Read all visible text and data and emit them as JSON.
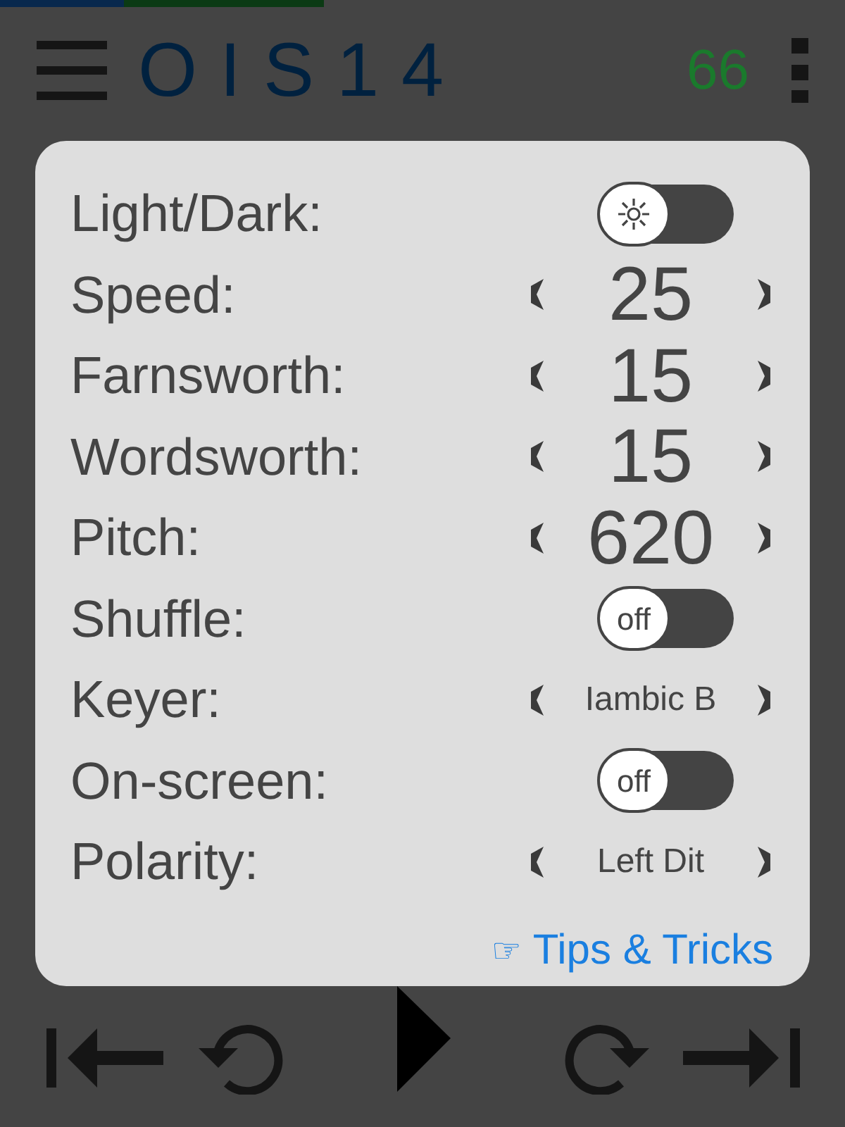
{
  "progress": {
    "level": 0.383
  },
  "header": {
    "title": "OIS14",
    "count": "66"
  },
  "settings": [
    {
      "label": "Light/Dark:",
      "kind": "toggle",
      "on": false
    },
    {
      "label": "Speed:",
      "kind": "number",
      "value": "25"
    },
    {
      "label": "Farnsworth:",
      "kind": "number",
      "value": "15"
    },
    {
      "label": "Wordsworth:",
      "kind": "number",
      "value": "15"
    },
    {
      "label": "Pitch:",
      "kind": "number",
      "value": "620"
    },
    {
      "label": "Shuffle:",
      "kind": "toggle",
      "on": false,
      "knob_text": "off"
    },
    {
      "label": "Keyer:",
      "kind": "choice",
      "value": "Iambic B"
    },
    {
      "label": "On-screen:",
      "kind": "toggle",
      "on": false,
      "knob_text": "off"
    },
    {
      "label": "Polarity:",
      "kind": "choice",
      "value": "Left Dit"
    }
  ],
  "tips_link": {
    "icon": "☞",
    "label": "Tips & Tricks"
  }
}
